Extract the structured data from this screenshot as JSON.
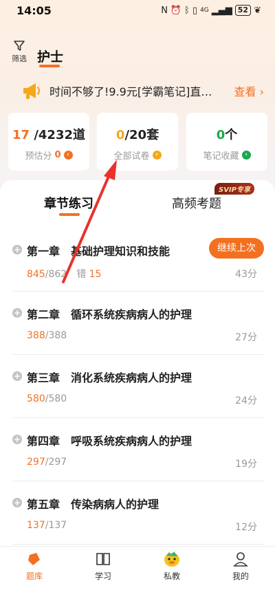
{
  "status_bar": {
    "time": "14:05",
    "network": "4G",
    "battery": "52"
  },
  "header": {
    "filter_label": "筛选",
    "title": "护士"
  },
  "banner": {
    "text": "时间不够了!9.9元[学霸笔记]直…",
    "link": "查看 ›"
  },
  "stats": [
    {
      "value": "17",
      "total": "/4232道",
      "label": "预估分",
      "badge": "0"
    },
    {
      "value": "0",
      "total": "/20套",
      "label": "全部试卷"
    },
    {
      "value": "0",
      "total": "个",
      "label": "笔记收藏"
    }
  ],
  "tabs": {
    "active": "章节练习",
    "other": "高频考题",
    "svip_badge": "SVIP专享"
  },
  "chapters": [
    {
      "title": "第一章　基础护理知识和技能",
      "done": "845",
      "total": "/862",
      "extra_label": "错",
      "extra_value": "15",
      "time": "43分",
      "action": "继续上次"
    },
    {
      "title": "第二章　循环系统疾病病人的护理",
      "done": "388",
      "total": "/388",
      "time": "27分"
    },
    {
      "title": "第三章　消化系统疾病病人的护理",
      "done": "580",
      "total": "/580",
      "time": "24分"
    },
    {
      "title": "第四章　呼吸系统疾病病人的护理",
      "done": "297",
      "total": "/297",
      "time": "19分"
    },
    {
      "title": "第五章　传染病病人的护理",
      "done": "137",
      "total": "/137",
      "time": "12分"
    }
  ],
  "nav": [
    {
      "label": "题库",
      "icon": "question-bank-icon"
    },
    {
      "label": "学习",
      "icon": "book-icon"
    },
    {
      "label": "私教",
      "icon": "tutor-avatar-icon"
    },
    {
      "label": "我的",
      "icon": "profile-icon"
    }
  ],
  "colors": {
    "accent": "#f37021",
    "annotation_arrow": "#e8322a"
  }
}
